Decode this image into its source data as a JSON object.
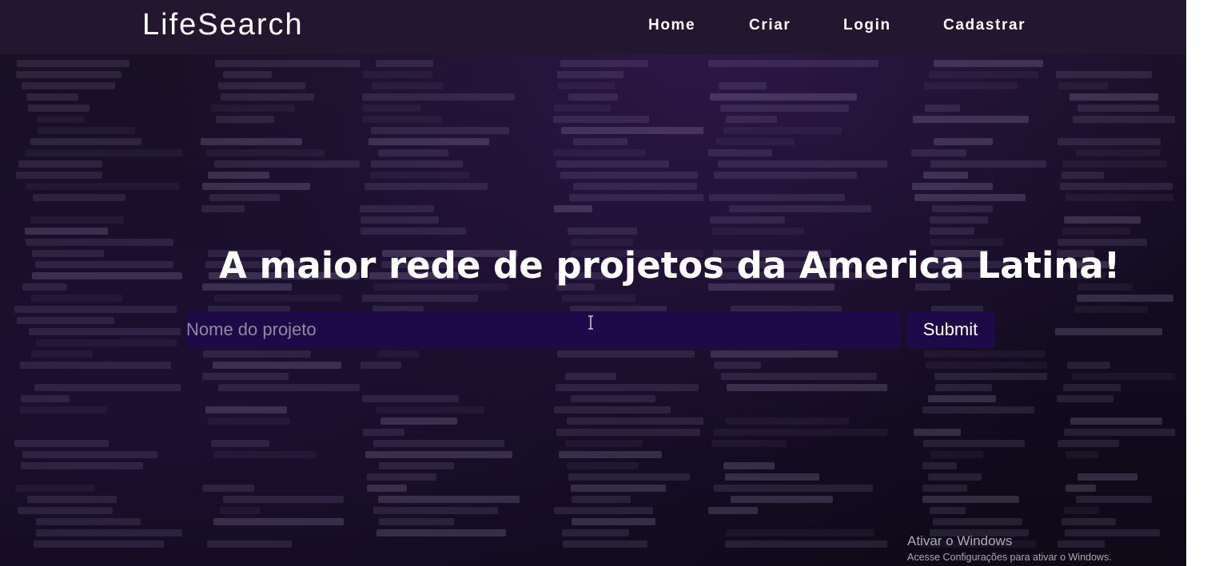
{
  "navbar": {
    "brand": "LifeSearch",
    "links": [
      {
        "label": "Home"
      },
      {
        "label": "Criar"
      },
      {
        "label": "Login"
      },
      {
        "label": "Cadastrar"
      }
    ]
  },
  "hero": {
    "headline": "A maior rede de projetos da America Latina!",
    "search": {
      "placeholder": "Nome do projeto",
      "value": ""
    },
    "submit_label": "Submit"
  },
  "watermark": {
    "title": "Ativar o Windows",
    "subtitle": "Acesse Configurações para ativar o Windows."
  },
  "colors": {
    "navbar_bg": "#231830",
    "input_bg": "#1e0a48",
    "text": "#ffffff"
  },
  "icons": {
    "cursor": "text-cursor-icon"
  }
}
